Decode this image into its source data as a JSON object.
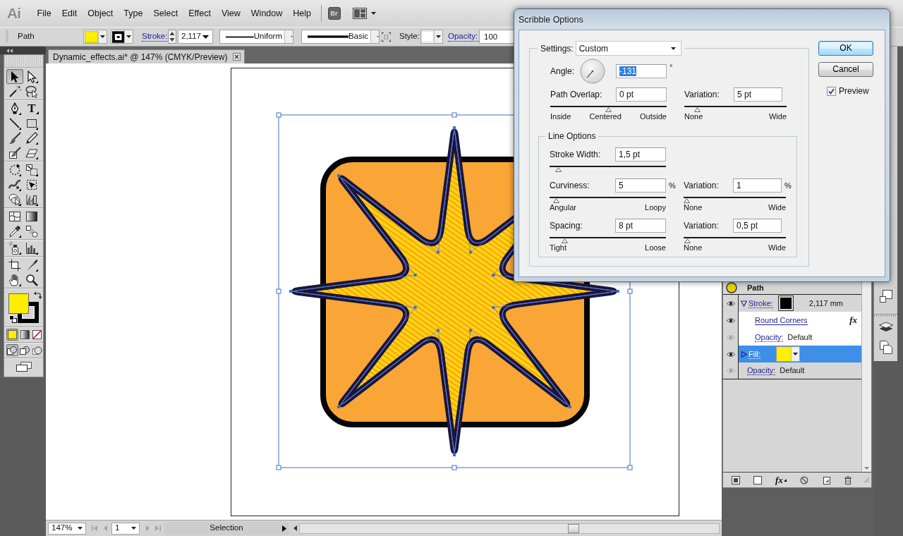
{
  "menu_bar": {
    "logo": "Ai",
    "items": [
      "File",
      "Edit",
      "Object",
      "Type",
      "Select",
      "Effect",
      "View",
      "Window",
      "Help"
    ],
    "bridge": "Br"
  },
  "control_bar": {
    "selection": "Path",
    "stroke_label": "Stroke:",
    "stroke_weight": "2,117",
    "profile": "Uniform",
    "brush": "Basic",
    "style_label": "Style:",
    "opacity_label": "Opacity:",
    "opacity": "100"
  },
  "document_tab": {
    "title": "Dynamic_effects.ai* @ 147% (CMYK/Preview)"
  },
  "toolbox": {
    "groups": [
      [
        {
          "kind": "selection",
          "selected": true,
          "flyout": false
        },
        {
          "kind": "direct_selection",
          "selected": false,
          "flyout": true
        },
        {
          "kind": "magic_wand",
          "selected": false,
          "flyout": false
        },
        {
          "kind": "lasso",
          "selected": false,
          "flyout": false
        }
      ],
      [
        {
          "kind": "pen",
          "selected": false,
          "flyout": true
        },
        {
          "kind": "type",
          "glyph": "T",
          "selected": false,
          "flyout": true
        },
        {
          "kind": "line",
          "selected": false,
          "flyout": true
        },
        {
          "kind": "rectangle",
          "selected": false,
          "flyout": true
        },
        {
          "kind": "paintbrush",
          "selected": false,
          "flyout": false
        },
        {
          "kind": "pencil",
          "selected": false,
          "flyout": true
        },
        {
          "kind": "blob_brush",
          "selected": false,
          "flyout": false
        },
        {
          "kind": "eraser",
          "selected": false,
          "flyout": true
        }
      ],
      [
        {
          "kind": "rotate",
          "selected": false,
          "flyout": true
        },
        {
          "kind": "scale",
          "selected": false,
          "flyout": true
        },
        {
          "kind": "width",
          "selected": false,
          "flyout": true
        },
        {
          "kind": "free_transform",
          "selected": false,
          "flyout": false
        },
        {
          "kind": "shape_builder",
          "selected": false,
          "flyout": true
        },
        {
          "kind": "perspective",
          "selected": false,
          "flyout": true
        }
      ],
      [
        {
          "kind": "mesh",
          "selected": false,
          "flyout": false
        },
        {
          "kind": "gradient",
          "selected": false,
          "flyout": false
        },
        {
          "kind": "eyedropper",
          "selected": false,
          "flyout": true
        },
        {
          "kind": "blend",
          "selected": false,
          "flyout": false
        }
      ],
      [
        {
          "kind": "symbol_sprayer",
          "selected": false,
          "flyout": true
        },
        {
          "kind": "column_graph",
          "selected": false,
          "flyout": true
        }
      ],
      [
        {
          "kind": "artboard",
          "selected": false,
          "flyout": false
        },
        {
          "kind": "slice",
          "selected": false,
          "flyout": true
        },
        {
          "kind": "hand",
          "selected": false,
          "flyout": true
        },
        {
          "kind": "zoom",
          "selected": false,
          "flyout": false
        }
      ]
    ],
    "fill_modes": [
      {
        "kind": "color",
        "selected": true
      },
      {
        "kind": "gradient",
        "selected": false
      },
      {
        "kind": "none",
        "selected": false
      }
    ],
    "draw_modes": [
      {
        "kind": "normal",
        "selected": true
      },
      {
        "kind": "behind",
        "selected": false
      },
      {
        "kind": "inside",
        "selected": false
      }
    ]
  },
  "dialog": {
    "title": "Scribble Options",
    "settings": {
      "label": "Settings:",
      "value": "Custom"
    },
    "angle": {
      "label": "Angle:",
      "value": "-131",
      "text_selected": true,
      "unit": "°"
    },
    "overlap_row": [
      {
        "label": "Path Overlap:",
        "value": "0 pt",
        "level": 0.5,
        "ticks": [
          "Inside",
          "Centered",
          "Outside"
        ]
      },
      {
        "label": "Variation:",
        "value": "5 pt",
        "level": 0.1,
        "ticks": [
          "None",
          "Wide"
        ]
      }
    ],
    "line_options": {
      "title": "Line Options",
      "rows": [
        [
          {
            "label": "Stroke Width:",
            "value": "1,5 pt",
            "level": 0.05
          }
        ],
        [
          {
            "label": "Curviness:",
            "value": "5",
            "unit": "%",
            "level": 0.03,
            "ticks": [
              "Angular",
              "Loopy"
            ]
          },
          {
            "label": "Variation:",
            "value": "1",
            "unit": "%",
            "level": 0,
            "ticks": [
              "None",
              "Wide"
            ]
          }
        ],
        [
          {
            "label": "Spacing:",
            "value": "8 pt",
            "level": 0.11,
            "ticks": [
              "Tight",
              "Loose"
            ]
          },
          {
            "label": "Variation:",
            "value": "0,5 pt",
            "level": 0.01,
            "ticks": [
              "None",
              "Wide"
            ]
          }
        ]
      ]
    },
    "buttons": [
      {
        "label": "OK",
        "default": true
      },
      {
        "label": "Cancel",
        "default": false
      }
    ],
    "preview": {
      "label": "Preview",
      "checked": true
    }
  },
  "appearance_panel": {
    "object": "Path",
    "rows": [
      {
        "kind": "stroke",
        "label": "Stroke:",
        "value": "2,117 mm",
        "expanded": true,
        "selected": false,
        "eye_dimmed": false,
        "children": [
          {
            "kind": "effect",
            "label": "Round Corners",
            "badge": "fx",
            "selected": false,
            "eye_dimmed": false
          },
          {
            "kind": "opacity",
            "label": "Opacity:",
            "value": "Default",
            "selected": false,
            "eye_dimmed": true
          }
        ]
      },
      {
        "kind": "fill",
        "label": "Fill:",
        "expanded": false,
        "selected": true,
        "eye_dimmed": false
      },
      {
        "kind": "opacity",
        "label": "Opacity:",
        "value": "Default",
        "selected": false,
        "eye_dimmed": true
      }
    ],
    "footer": [
      {
        "kind": "basic"
      },
      {
        "kind": "clear"
      },
      {
        "kind": "effect",
        "glyph": "fx"
      },
      {
        "kind": "reduce"
      },
      {
        "kind": "duplicate"
      },
      {
        "kind": "delete"
      }
    ]
  },
  "status_bar": {
    "zoom": "147%",
    "page": "1",
    "page_nav": [
      {
        "kind": "first",
        "disabled": true
      },
      {
        "kind": "prev",
        "disabled": true
      },
      {
        "kind": "next",
        "disabled": true
      },
      {
        "kind": "last",
        "disabled": true
      }
    ],
    "tool": "Selection"
  }
}
